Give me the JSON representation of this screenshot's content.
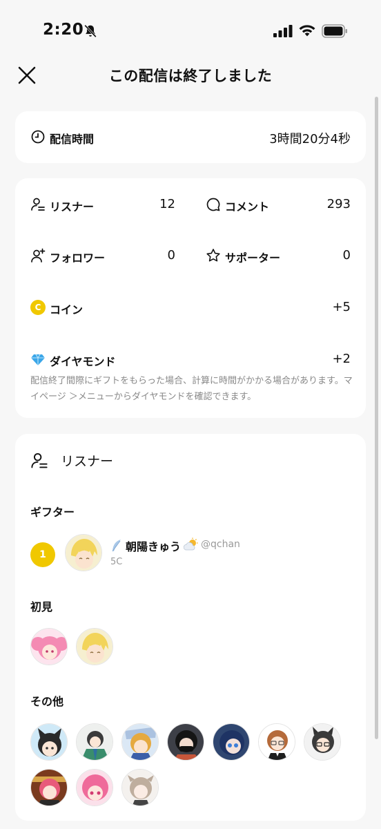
{
  "status_bar": {
    "time": "2:20"
  },
  "header": {
    "title": "この配信は終了しました"
  },
  "duration": {
    "label": "配信時間",
    "value": "3時間20分4秒"
  },
  "stats": {
    "listeners": {
      "label": "リスナー",
      "value": "12"
    },
    "comments": {
      "label": "コメント",
      "value": "293"
    },
    "followers": {
      "label": "フォロワー",
      "value": "0"
    },
    "supporters": {
      "label": "サポーター",
      "value": "0"
    },
    "coins": {
      "label": "コイン",
      "value": "+5",
      "icon_letter": "C"
    },
    "diamonds": {
      "label": "ダイヤモンド",
      "value": "+2"
    },
    "note": "配信終了間際にギフトをもらった場合、計算に時間がかかる場合があります。マイページ ＞メニューからダイヤモンドを確認できます。"
  },
  "listeners_section": {
    "title": "リスナー",
    "gifter_title": "ギフター",
    "gifters": [
      {
        "rank": "1",
        "name": "朝陽きゅう",
        "handle": "@qchan",
        "coins": "5C"
      }
    ],
    "first_time_title": "初見",
    "others_title": "その他"
  },
  "colors": {
    "accent_yellow": "#f0c800",
    "diamond_blue": "#3aa6e8",
    "background": "#f7f7f7"
  }
}
